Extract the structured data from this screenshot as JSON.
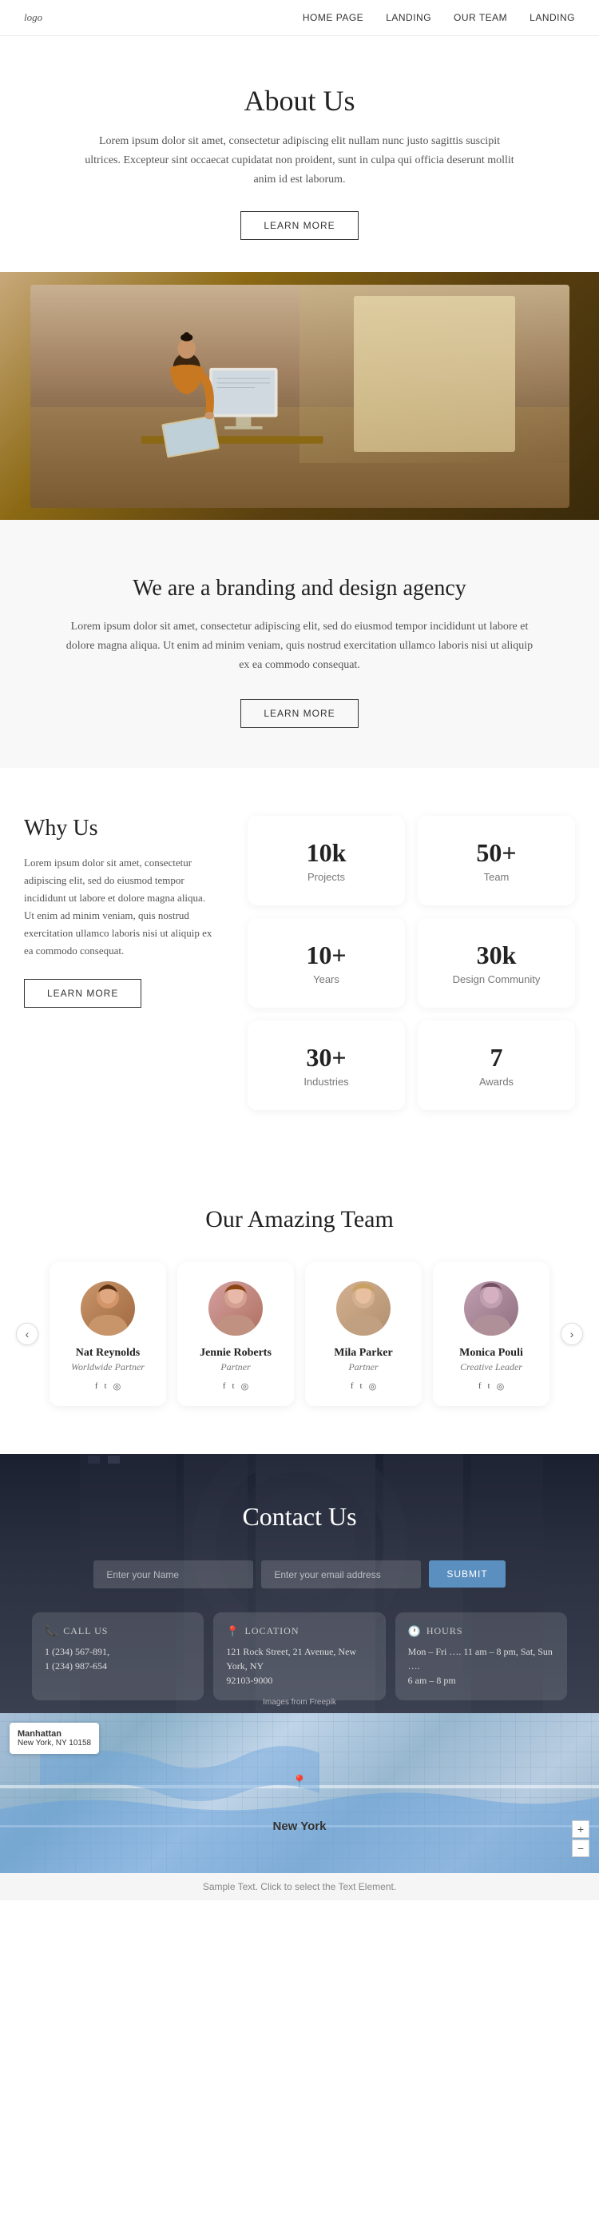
{
  "nav": {
    "logo": "logo",
    "links": [
      "HOME PAGE",
      "LANDING",
      "OUR TEAM",
      "LANDING"
    ]
  },
  "about": {
    "title": "About Us",
    "description": "Lorem ipsum dolor sit amet, consectetur adipiscing elit nullam nunc justo sagittis suscipit ultrices. Excepteur sint occaecat cupidatat non proident, sunt in culpa qui officia deserunt mollit anim id est laborum.",
    "btn": "LEARN MORE"
  },
  "branding": {
    "title": "We are a branding and design agency",
    "description": "Lorem ipsum dolor sit amet, consectetur adipiscing elit, sed do eiusmod tempor incididunt ut labore et dolore magna aliqua. Ut enim ad minim veniam, quis nostrud exercitation ullamco laboris nisi ut aliquip ex ea commodo consequat.",
    "btn": "LEARN MORE"
  },
  "why": {
    "title": "Why Us",
    "description": "Lorem ipsum dolor sit amet, consectetur adipiscing elit, sed do eiusmod tempor incididunt ut labore et dolore magna aliqua. Ut enim ad minim veniam, quis nostrud exercitation ullamco laboris nisi ut aliquip ex ea commodo consequat.",
    "btn": "LEARN MORE",
    "stats": [
      {
        "num": "10k",
        "label": "Projects"
      },
      {
        "num": "50+",
        "label": "Team"
      },
      {
        "num": "10+",
        "label": "Years"
      },
      {
        "num": "30k",
        "label": "Design Community"
      },
      {
        "num": "30+",
        "label": "Industries"
      },
      {
        "num": "7",
        "label": "Awards"
      }
    ]
  },
  "team": {
    "title": "Our Amazing Team",
    "members": [
      {
        "name": "Nat Reynolds",
        "role": "Worldwide Partner"
      },
      {
        "name": "Jennie Roberts",
        "role": "Partner"
      },
      {
        "name": "Mila Parker",
        "role": "Partner"
      },
      {
        "name": "Monica Pouli",
        "role": "Creative Leader"
      }
    ]
  },
  "contact": {
    "title": "Contact Us",
    "name_placeholder": "Enter your Name",
    "email_placeholder": "Enter your email address",
    "submit_btn": "SUBMIT",
    "cards": [
      {
        "icon": "📞",
        "title": "CALL US",
        "lines": [
          "1 (234) 567-891,",
          "1 (234) 987-654"
        ]
      },
      {
        "icon": "📍",
        "title": "LOCATION",
        "lines": [
          "121 Rock Street, 21 Avenue, New York, NY",
          "92103-9000"
        ]
      },
      {
        "icon": "🕐",
        "title": "HOURS",
        "lines": [
          "Mon – Fri …. 11 am – 8 pm, Sat, Sun ….",
          "6 am – 8 pm"
        ]
      }
    ]
  },
  "map": {
    "label": "New York",
    "city": "Manhattan",
    "state": "New York, NY 10158",
    "zoom_in": "+",
    "zoom_out": "−"
  },
  "footer": {
    "sample_text": "Sample Text. Click to select the Text Element.",
    "freepik": "Images from Freepik"
  }
}
